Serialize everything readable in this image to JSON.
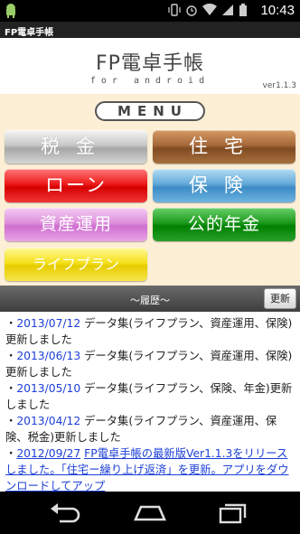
{
  "status": {
    "time": "10:43",
    "icons": [
      "android-icon",
      "vibrate-icon",
      "alarm-icon",
      "wifi-icon",
      "signal-icon",
      "battery-icon"
    ]
  },
  "app": {
    "window_title": "FP電卓手帳"
  },
  "header": {
    "title": "FP電卓手帳",
    "subtitle": "for android",
    "version": "ver1.1.3"
  },
  "menu": {
    "title": "MENU",
    "buttons": {
      "tax": "税金",
      "housing": "住宅",
      "loan": "ローン",
      "insurance": "保険",
      "asset": "資産運用",
      "pension": "公的年金",
      "lifeplan": "ライフプラン"
    }
  },
  "history": {
    "label": "〜履歴〜",
    "refresh": "更新",
    "items": [
      {
        "date": "2013/07/12",
        "text": "データ集(ライフプラン、資産運用、保険)更新しました"
      },
      {
        "date": "2013/06/13",
        "text": "データ集(ライフプラン、資産運用、保険)更新しました"
      },
      {
        "date": "2013/05/10",
        "text": "データ集(ライフプラン、保険、年金)更新しました"
      },
      {
        "date": "2013/04/12",
        "text": "データ集(ライフプラン、資産運用、保険、税金)更新しました"
      },
      {
        "date": "2012/09/27",
        "text": "FP電卓手帳の最新版Ver1.1.3をリリースしました。「住宅ー繰り上げ返済」を更新。アプリをダウンロードしてアップ"
      }
    ]
  },
  "colors": {
    "menu_bg": "#fcefd6",
    "link": "#1c3fd8"
  }
}
